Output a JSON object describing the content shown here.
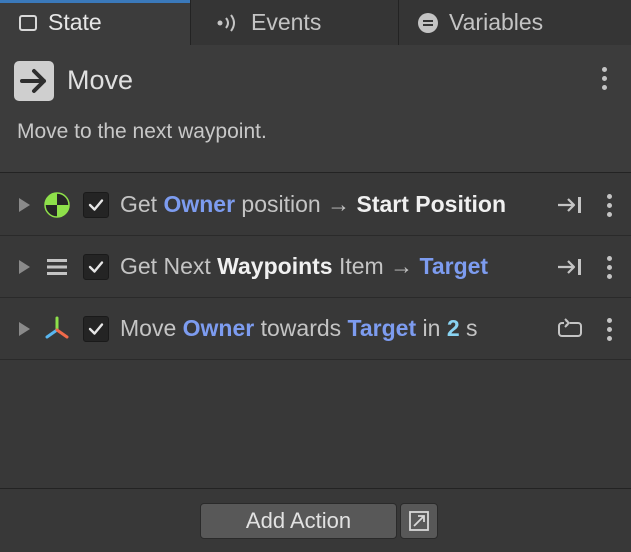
{
  "tabs": [
    {
      "label": "State",
      "icon": "square-outline-icon",
      "active": true
    },
    {
      "label": "Events",
      "icon": "broadcast-icon",
      "active": false
    },
    {
      "label": "Variables",
      "icon": "variables-icon",
      "active": false
    }
  ],
  "state": {
    "icon": "arrow-right-icon",
    "name": "Move",
    "description": "Move to the next waypoint."
  },
  "actions": [
    {
      "icon": "position-target-icon",
      "checked": true,
      "parts": {
        "p1": "Get ",
        "p2": "Owner",
        "p3": " position → ",
        "p4": "Start Position"
      },
      "end_icon": "step-end-icon"
    },
    {
      "icon": "list-icon",
      "checked": true,
      "parts": {
        "p1": "Get Next ",
        "p2": "Waypoints",
        "p3": " Item → ",
        "p4": "Target"
      },
      "end_icon": "step-end-icon"
    },
    {
      "icon": "transform-axes-icon",
      "checked": true,
      "parts": {
        "p1": "Move ",
        "p2": "Owner",
        "p3": " towards ",
        "p4": "Target",
        "p5": " in ",
        "p6": "2",
        "p7": " s"
      },
      "end_icon": "loop-icon"
    }
  ],
  "footer": {
    "add_action_label": "Add Action",
    "open_icon": "open-external-icon"
  },
  "colors": {
    "accent_tab": "#3a79bb",
    "keyword_blue": "#7d9cf0",
    "number_cyan": "#89d3f2",
    "background": "#383838"
  }
}
